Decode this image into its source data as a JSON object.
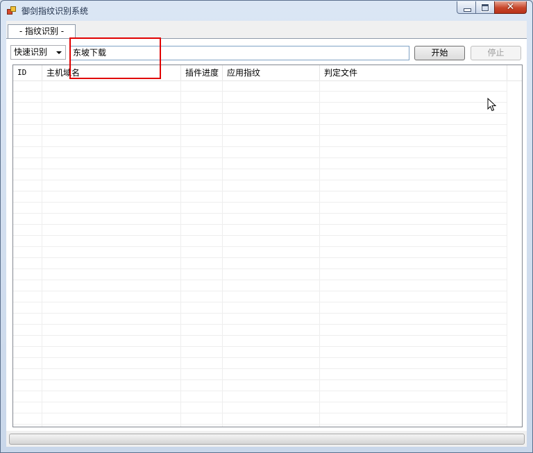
{
  "window": {
    "title": "御剑指纹识别系统"
  },
  "tab": {
    "label": "- 指纹识别 -"
  },
  "toolbar": {
    "mode": "快速识别",
    "url_value": "东坡下载",
    "start_label": "开始",
    "stop_label": "停止"
  },
  "table": {
    "columns": [
      "ID",
      "主机域名",
      "插件进度",
      "应用指纹",
      "判定文件"
    ],
    "rows": []
  },
  "progress": {
    "value": 0
  },
  "colors": {
    "highlight": "#e00000",
    "title_bg": "#c9d7ea",
    "close_button": "#c7452a"
  }
}
